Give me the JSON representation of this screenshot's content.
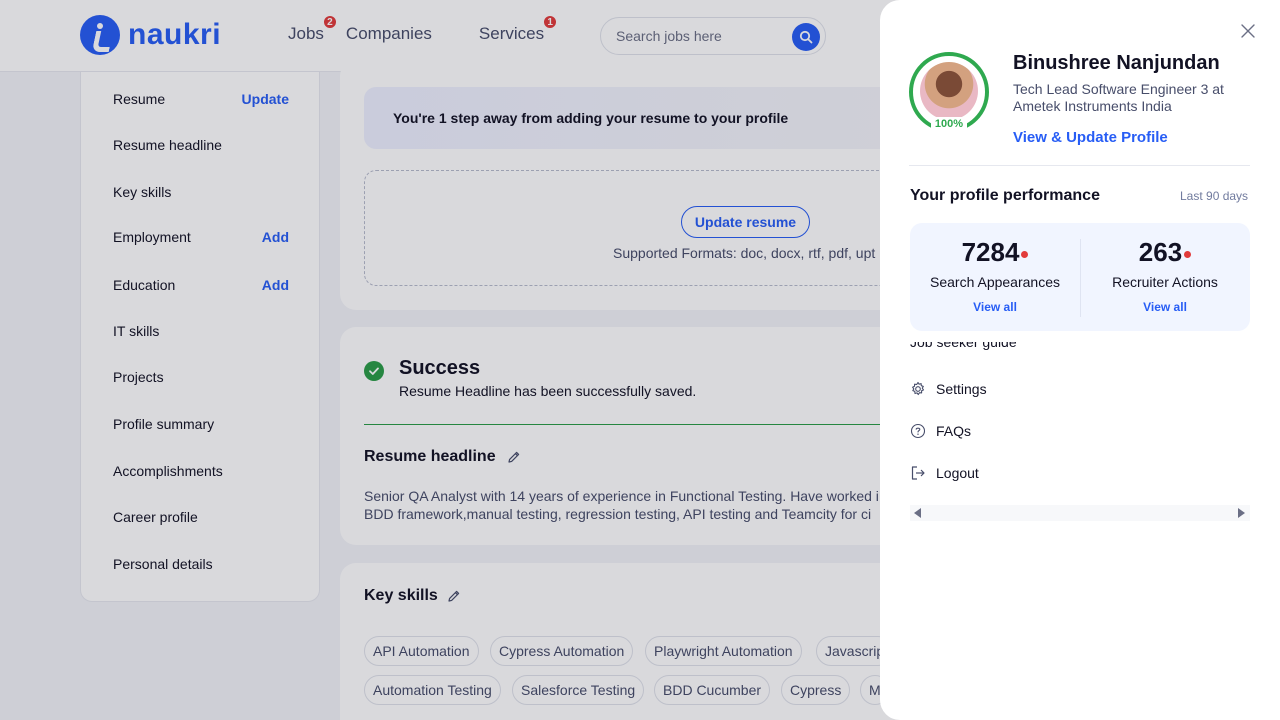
{
  "header": {
    "logo_text": "naukri",
    "nav": [
      {
        "label": "Jobs",
        "badge": "2"
      },
      {
        "label": "Companies",
        "badge": ""
      },
      {
        "label": "Services",
        "badge": "1"
      }
    ],
    "search_placeholder": "Search jobs here"
  },
  "sidebar": {
    "items": [
      {
        "label": "Resume",
        "action": "Update"
      },
      {
        "label": "Resume headline",
        "action": ""
      },
      {
        "label": "Key skills",
        "action": ""
      },
      {
        "label": "Employment",
        "action": "Add"
      },
      {
        "label": "Education",
        "action": "Add"
      },
      {
        "label": "IT skills",
        "action": ""
      },
      {
        "label": "Projects",
        "action": ""
      },
      {
        "label": "Profile summary",
        "action": ""
      },
      {
        "label": "Accomplishments",
        "action": ""
      },
      {
        "label": "Career profile",
        "action": ""
      },
      {
        "label": "Personal details",
        "action": ""
      }
    ]
  },
  "resume_card": {
    "banner": "You're 1 step away from adding your resume to your profile",
    "update_button": "Update resume",
    "formats": "Supported Formats: doc, docx, rtf, pdf, upt"
  },
  "headline_card": {
    "success_title": "Success",
    "success_message": "Resume Headline has been successfully saved.",
    "section_title": "Resume headline",
    "text_line1": "Senior QA Analyst with 14 years of experience in Functional Testing. Have worked i",
    "text_line2": "BDD framework,manual testing, regression testing, API testing and Teamcity for ci"
  },
  "skills_card": {
    "section_title": "Key skills",
    "row1": [
      "API Automation",
      "Cypress Automation",
      "Playwright Automation",
      "Javascrip"
    ],
    "row2": [
      "Automation Testing",
      "Salesforce Testing",
      "BDD Cucumber",
      "Cypress",
      "M"
    ]
  },
  "drawer": {
    "completion": "100%",
    "name": "Binushree Nanjundan",
    "role": "Tech Lead Software Engineer 3 at Ametek Instruments India",
    "profile_link": "View & Update Profile",
    "performance_title": "Your profile performance",
    "performance_period": "Last 90 days",
    "stats": [
      {
        "value": "7284",
        "label": "Search Appearances",
        "link": "View all"
      },
      {
        "value": "263",
        "label": "Recruiter Actions",
        "link": "View all"
      }
    ],
    "partial_item": "Job seeker guide",
    "menu": [
      {
        "label": "Settings",
        "icon": "gear-icon"
      },
      {
        "label": "FAQs",
        "icon": "question-icon"
      },
      {
        "label": "Logout",
        "icon": "logout-icon"
      }
    ]
  },
  "colors": {
    "brand": "#275df5",
    "success": "#2a9d47",
    "badge": "#e23b3b"
  }
}
